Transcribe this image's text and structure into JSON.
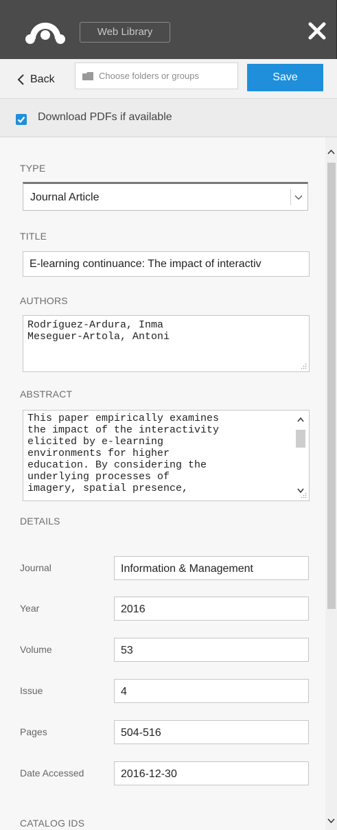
{
  "header": {
    "logo_icon": "mendeley-logo-icon",
    "web_library_label": "Web Library",
    "close_icon": "close-icon"
  },
  "actions": {
    "back_label": "Back",
    "folder_placeholder": "Choose folders or groups",
    "save_label": "Save"
  },
  "download": {
    "checked": true,
    "label": "Download PDFs if available"
  },
  "form": {
    "type_label": "TYPE",
    "type_value": "Journal Article",
    "title_label": "TITLE",
    "title_value": "E-learning continuance: The impact of interactiv",
    "authors_label": "AUTHORS",
    "authors": [
      "Rodríguez-Ardura, Inma",
      "Meseguer-Artola, Antoni"
    ],
    "abstract_label": "ABSTRACT",
    "abstract_lines": [
      "This paper empirically examines",
      "the impact of the interactivity",
      "elicited by e-learning",
      "environments for higher",
      "education. By considering the",
      "underlying processes of",
      "imagery, spatial presence,"
    ],
    "details_label": "DETAILS",
    "details": [
      {
        "label": "Journal",
        "value": "Information & Management"
      },
      {
        "label": "Year",
        "value": "2016"
      },
      {
        "label": "Volume",
        "value": "53"
      },
      {
        "label": "Issue",
        "value": "4"
      },
      {
        "label": "Pages",
        "value": "504-516"
      },
      {
        "label": "Date Accessed",
        "value": "2016-12-30"
      }
    ],
    "catalog_label": "CATALOG IDS"
  },
  "colors": {
    "header_bg": "#4b4b4b",
    "accent": "#1f8fdb"
  }
}
